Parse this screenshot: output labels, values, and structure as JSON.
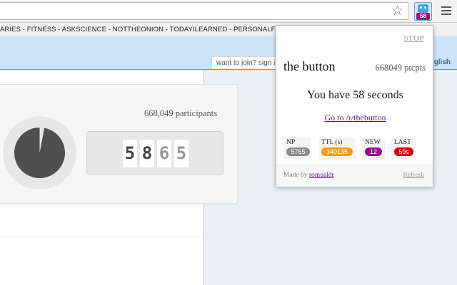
{
  "browser": {
    "star_icon": "star-outline-icon",
    "extension": {
      "badge": "58",
      "icon": "robot-icon"
    },
    "menu_icon": "hamburger-menu-icon"
  },
  "subreddit_bar": {
    "text": "ARIES - FITNESS - ASKSCIENCE - NOTTHEONION - TODAYILEARNED - PERSONALFINANCE"
  },
  "header": {
    "join_text": "want to join? sign in",
    "prefs_text": "english"
  },
  "main": {
    "participants": "668,049 participants",
    "digits": [
      "5",
      "8",
      "6",
      "5"
    ],
    "timer_remaining_fraction": 0.97
  },
  "popup": {
    "stop": "STOP",
    "title": "the button",
    "ptcpts": "668049 ptcpts",
    "seconds": "You have 58 seconds",
    "link": "Go to /r/thebutton",
    "stats": [
      {
        "label": "NP",
        "value": "5765",
        "color": "#8c8c8c"
      },
      {
        "label": "TTL (s)",
        "value": "340135",
        "color": "#e6a01e"
      },
      {
        "label": "NEW",
        "value": "12",
        "color": "#8a168a"
      },
      {
        "label": "LAST",
        "value": "59s",
        "color": "#d8000c"
      }
    ],
    "made_by_prefix": "Made by",
    "made_by_author": "romualdr",
    "refresh": "Refresh"
  },
  "colors": {
    "header_blue": "#cee3f8",
    "popup_link": "#551a8b",
    "digit_dark": "#444444",
    "digit_light": "#999999"
  }
}
